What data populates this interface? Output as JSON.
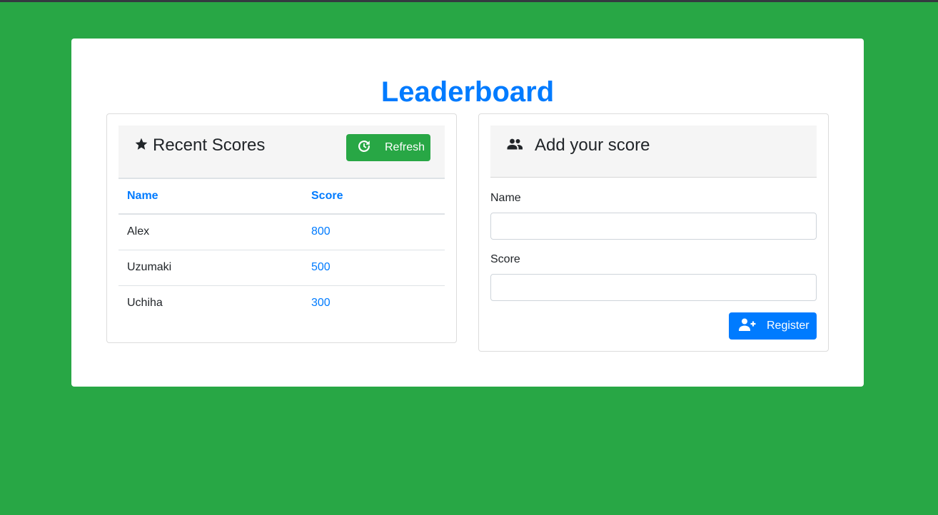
{
  "page": {
    "title": "Leaderboard"
  },
  "recent_scores": {
    "title": "Recent Scores",
    "icon": "star-icon",
    "refresh_label": "Refresh",
    "refresh_icon": "refresh-icon",
    "columns": [
      "Name",
      "Score"
    ],
    "rows": [
      {
        "name": "Alex",
        "score": "800"
      },
      {
        "name": "Uzumaki",
        "score": "500"
      },
      {
        "name": "Uchiha",
        "score": "300"
      }
    ]
  },
  "add_score": {
    "title": "Add your score",
    "icon": "users-icon",
    "name_label": "Name",
    "name_value": "",
    "score_label": "Score",
    "score_value": "",
    "register_label": "Register",
    "register_icon": "add-user-icon"
  },
  "colors": {
    "background": "#28a745",
    "accent": "#007bff",
    "refresh_button": "#28a745",
    "register_button": "#007bff"
  }
}
